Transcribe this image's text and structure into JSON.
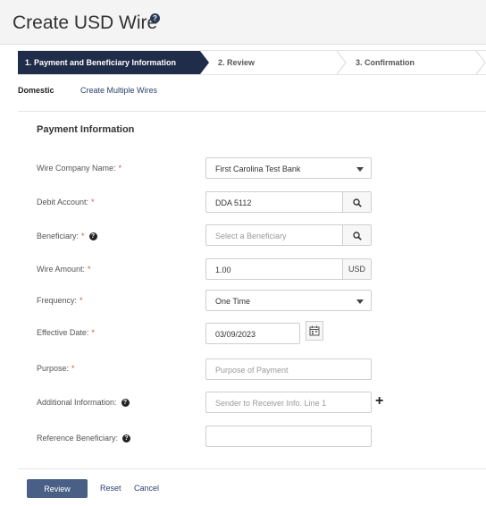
{
  "header": {
    "title": "Create USD Wire",
    "help_glyph": "?"
  },
  "stepper": {
    "steps": [
      {
        "label": "1. Payment and Beneficiary Information"
      },
      {
        "label": "2. Review"
      },
      {
        "label": "3. Confirmation"
      }
    ]
  },
  "subtabs": {
    "domestic": "Domestic",
    "multiple": "Create Multiple Wires"
  },
  "form": {
    "section_title": "Payment Information",
    "required_mark": "*",
    "help_glyph": "?",
    "wire_company": {
      "label": "Wire Company Name:",
      "value": "First Carolina Test Bank"
    },
    "debit_account": {
      "label": "Debit Account:",
      "value": "DDA 5112"
    },
    "beneficiary": {
      "label": "Beneficiary:",
      "placeholder": "Select a Beneficiary"
    },
    "wire_amount": {
      "label": "Wire Amount:",
      "value": "1.00",
      "currency": "USD"
    },
    "frequency": {
      "label": "Frequency:",
      "value": "One Time"
    },
    "effective_date": {
      "label": "Effective Date:",
      "value": "03/09/2023"
    },
    "purpose": {
      "label": "Purpose:",
      "placeholder": "Purpose of Payment"
    },
    "additional_info": {
      "label": "Additional Information:",
      "placeholder": "Sender to Receiver Info. Line 1",
      "add_glyph": "+"
    },
    "reference_beneficiary": {
      "label": "Reference Beneficiary:",
      "value": ""
    }
  },
  "footer": {
    "review": "Review",
    "reset": "Reset",
    "cancel": "Cancel"
  },
  "colors": {
    "active_step": "#1f2d4a",
    "primary_button": "#4a5f85",
    "required": "#d9534f",
    "link": "#2a3f6b"
  },
  "icons": {
    "search": "magnifier-icon",
    "calendar": "calendar-icon",
    "dropdown": "caret-down-icon",
    "add": "plus-icon"
  }
}
